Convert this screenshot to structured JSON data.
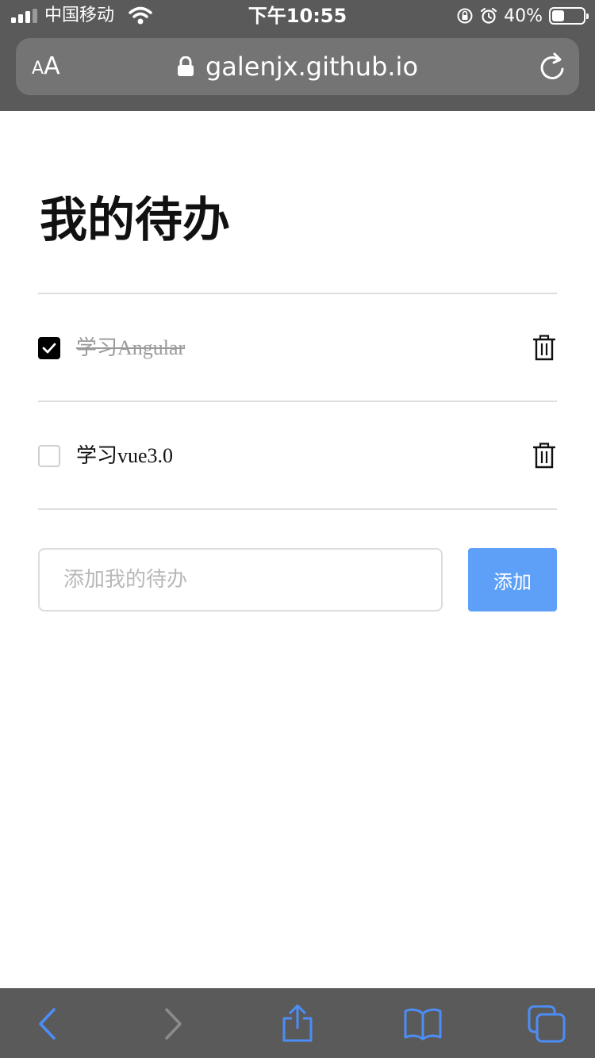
{
  "status_bar": {
    "carrier": "中国移动",
    "time": "下午10:55",
    "battery_text": "40%",
    "battery_level": 0.4
  },
  "browser": {
    "text_size_label_small": "A",
    "text_size_label_large": "A",
    "url": "galenjx.github.io"
  },
  "page": {
    "title": "我的待办",
    "todos": [
      {
        "text": "学习Angular",
        "done": true
      },
      {
        "text": "学习vue3.0",
        "done": false
      }
    ],
    "input": {
      "placeholder": "添加我的待办",
      "value": ""
    },
    "add_button_label": "添加"
  },
  "colors": {
    "browser_chrome": "#5a5a5a",
    "accent_blue": "#5ea0f7",
    "toolbar_icon_blue": "#4c8df6"
  }
}
